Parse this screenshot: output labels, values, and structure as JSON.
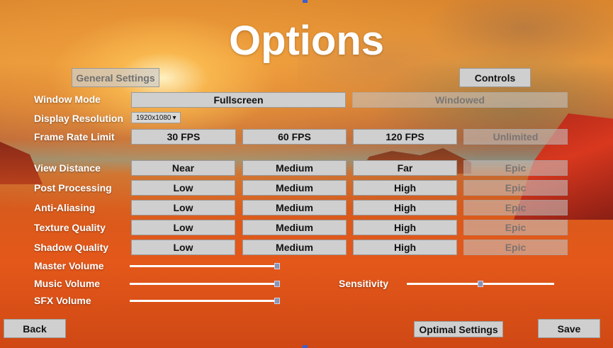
{
  "title": "Options",
  "tabs": {
    "general": "General Settings",
    "controls": "Controls"
  },
  "window_mode": {
    "label": "Window Mode",
    "options": [
      "Fullscreen",
      "Windowed"
    ]
  },
  "display_resolution": {
    "label": "Display Resolution",
    "value": "1920x1080"
  },
  "frame_rate": {
    "label": "Frame Rate Limit",
    "options": [
      "30 FPS",
      "60 FPS",
      "120 FPS",
      "Unlimited"
    ]
  },
  "view_distance": {
    "label": "View Distance",
    "options": [
      "Near",
      "Medium",
      "Far",
      "Epic"
    ]
  },
  "post_processing": {
    "label": "Post Processing",
    "options": [
      "Low",
      "Medium",
      "High",
      "Epic"
    ]
  },
  "anti_aliasing": {
    "label": "Anti-Aliasing",
    "options": [
      "Low",
      "Medium",
      "High",
      "Epic"
    ]
  },
  "texture_quality": {
    "label": "Texture Quality",
    "options": [
      "Low",
      "Medium",
      "High",
      "Epic"
    ]
  },
  "shadow_quality": {
    "label": "Shadow Quality",
    "options": [
      "Low",
      "Medium",
      "High",
      "Epic"
    ]
  },
  "master_volume": {
    "label": "Master Volume",
    "value": 1.0
  },
  "music_volume": {
    "label": "Music Volume",
    "value": 1.0
  },
  "sfx_volume": {
    "label": "SFX Volume",
    "value": 1.0
  },
  "sensitivity": {
    "label": "Sensitivity",
    "value": 0.5
  },
  "footer": {
    "back": "Back",
    "optimal": "Optimal Settings",
    "save": "Save"
  },
  "colors": {
    "button_bg": "#cfcfcf",
    "disabled_bg": "#c8c8c8",
    "slider_knob": "#8a93b8"
  }
}
